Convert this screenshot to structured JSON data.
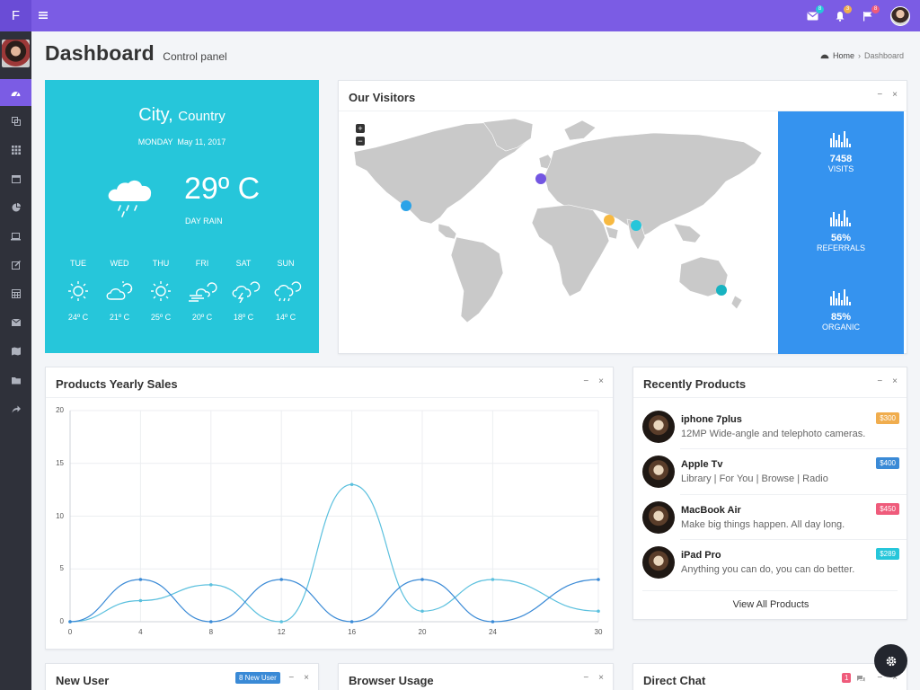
{
  "brand": "F",
  "header": {
    "notif_counts": [
      "8",
      "3",
      "8"
    ]
  },
  "page": {
    "title": "Dashboard",
    "subtitle": "Control panel"
  },
  "breadcrumb": {
    "home": "Home",
    "current": "Dashboard"
  },
  "weather": {
    "city": "City,",
    "country": "Country",
    "date": "MONDAY  May 11, 2017",
    "temp": "29º C",
    "condition": "DAY RAIN",
    "forecast": [
      {
        "day": "TUE",
        "temp": "24º C",
        "icon": "sun-icon"
      },
      {
        "day": "WED",
        "temp": "21º C",
        "icon": "cloud-sun-icon"
      },
      {
        "day": "THU",
        "temp": "25º C",
        "icon": "sun-icon"
      },
      {
        "day": "FRI",
        "temp": "20º C",
        "icon": "wind-cloud-icon"
      },
      {
        "day": "SAT",
        "temp": "18º C",
        "icon": "storm-icon"
      },
      {
        "day": "SUN",
        "temp": "14º C",
        "icon": "rain-icon"
      }
    ]
  },
  "visitors": {
    "title": "Our Visitors",
    "zoom_in": "+",
    "zoom_out": "−",
    "stats": [
      {
        "value": "7458",
        "label": "VISITS"
      },
      {
        "value": "56%",
        "label": "REFERRALS"
      },
      {
        "value": "85%",
        "label": "ORGANIC"
      }
    ]
  },
  "sales": {
    "title": "Products Yearly Sales"
  },
  "chart_data": {
    "type": "line",
    "title": "Products Yearly Sales",
    "x": [
      0,
      4,
      8,
      12,
      16,
      20,
      24,
      30
    ],
    "ylim": [
      0,
      20
    ],
    "yticks": [
      0,
      5,
      10,
      15,
      20
    ],
    "grid": true,
    "series": [
      {
        "values": [
          0,
          2,
          3.5,
          0,
          13,
          1,
          4,
          1
        ],
        "color": "#5bc0de"
      },
      {
        "values": [
          0,
          4,
          0,
          4,
          0,
          4,
          0,
          4
        ],
        "color": "#3a8ad6"
      }
    ]
  },
  "products": {
    "title": "Recently Products",
    "items": [
      {
        "name": "iphone 7plus",
        "desc": "12MP Wide-angle and telephoto cameras.",
        "price": "$300",
        "color": "#f0ad4e"
      },
      {
        "name": "Apple Tv",
        "desc": "Library | For You | Browse | Radio",
        "price": "$400",
        "color": "#3a8ad6"
      },
      {
        "name": "MacBook Air",
        "desc": "Make big things happen. All day long.",
        "price": "$450",
        "color": "#ef5b7b"
      },
      {
        "name": "iPad Pro",
        "desc": "Anything you can do, you can do better.",
        "price": "$289",
        "color": "#26c6da"
      }
    ],
    "view_all": "View All Products"
  },
  "new_user": {
    "title": "New User",
    "badge": "8 New User"
  },
  "browser": {
    "title": "Browser Usage"
  },
  "chat": {
    "title": "Direct Chat",
    "badge": "1"
  },
  "tools": {
    "minimize": "−",
    "close": "×"
  },
  "colors": {
    "primary": "#7b5ce4",
    "weather_bg": "#26c6da",
    "stats_bg": "#3593ef",
    "sidebar": "#2f313a"
  }
}
